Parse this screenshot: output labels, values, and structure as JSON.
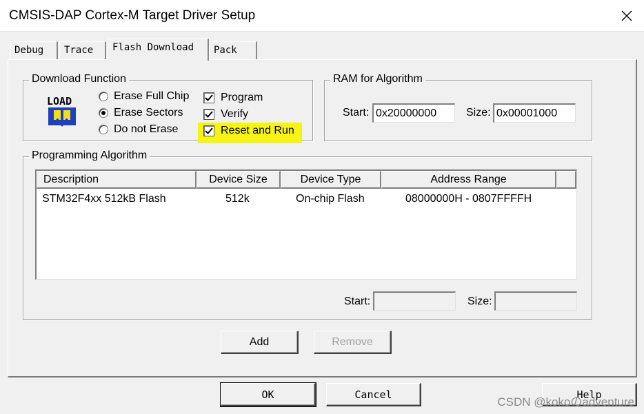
{
  "window": {
    "title": "CMSIS-DAP Cortex-M Target Driver Setup"
  },
  "tabs": [
    {
      "label": "Debug"
    },
    {
      "label": "Trace"
    },
    {
      "label": "Flash Download"
    },
    {
      "label": "Pack"
    }
  ],
  "active_tab": "Flash Download",
  "download_function": {
    "label": "Download Function",
    "icon_text": "LOAD",
    "radios": [
      {
        "label": "Erase Full Chip",
        "selected": false
      },
      {
        "label": "Erase Sectors",
        "selected": true
      },
      {
        "label": "Do not Erase",
        "selected": false
      }
    ],
    "checks": [
      {
        "label": "Program",
        "checked": true
      },
      {
        "label": "Verify",
        "checked": true
      },
      {
        "label": "Reset and Run",
        "checked": true
      }
    ]
  },
  "ram": {
    "label": "RAM for Algorithm",
    "start_label": "Start:",
    "start_value": "0x20000000",
    "size_label": "Size:",
    "size_value": "0x00001000"
  },
  "algorithm": {
    "label": "Programming Algorithm",
    "columns": [
      "Description",
      "Device Size",
      "Device Type",
      "Address Range"
    ],
    "rows": [
      {
        "description": "STM32F4xx 512kB Flash",
        "size": "512k",
        "type": "On-chip Flash",
        "range": "08000000H - 0807FFFFH"
      }
    ],
    "start_label": "Start:",
    "start_value": "",
    "size_label": "Size:",
    "size_value": ""
  },
  "buttons": {
    "add": "Add",
    "remove": "Remove",
    "ok": "OK",
    "cancel": "Cancel",
    "help": "Help"
  },
  "watermark": "CSDN @kokoのadventure",
  "colors": {
    "highlight": "#f6f316",
    "load_icon_blue": "#1f3fbf",
    "load_icon_yellow": "#f2e01a"
  }
}
